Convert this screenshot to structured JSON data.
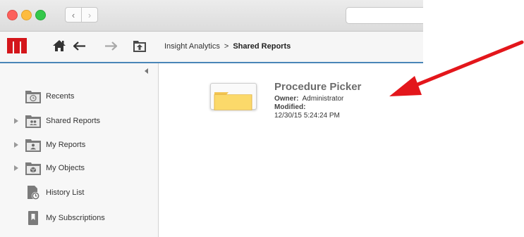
{
  "toolbar": {
    "breadcrumb": {
      "root": "Insight Analytics",
      "separator": ">",
      "current": "Shared Reports"
    }
  },
  "sidebar": {
    "items": [
      {
        "label": "Recents",
        "icon": "recents-folder-icon",
        "expandable": false
      },
      {
        "label": "Shared Reports",
        "icon": "shared-reports-folder-icon",
        "expandable": true
      },
      {
        "label": "My Reports",
        "icon": "my-reports-folder-icon",
        "expandable": true
      },
      {
        "label": "My Objects",
        "icon": "my-objects-folder-icon",
        "expandable": true
      },
      {
        "label": "History List",
        "icon": "history-list-icon",
        "expandable": false
      },
      {
        "label": "My Subscriptions",
        "icon": "subscriptions-icon",
        "expandable": false
      }
    ]
  },
  "content": {
    "item": {
      "name": "Procedure Picker",
      "owner_label": "Owner:",
      "owner": "Administrator",
      "modified_label": "Modified:",
      "modified": "12/30/15 5:24:24 PM"
    }
  },
  "colors": {
    "accent": "#4a86b8",
    "logo": "#d4161b",
    "folder": "#fbd96a",
    "annotation_arrow": "#e3161b"
  }
}
